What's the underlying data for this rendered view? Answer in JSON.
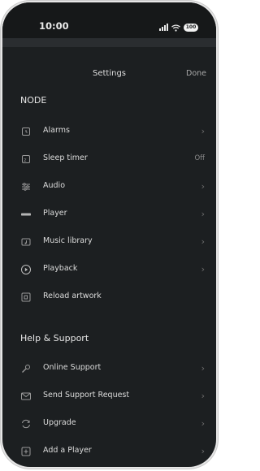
{
  "status_bar": {
    "time": "10:00",
    "battery": "100"
  },
  "header": {
    "title": "Settings",
    "done_label": "Done"
  },
  "sections": {
    "node": {
      "heading": "NODE",
      "items": [
        {
          "label": "Alarms",
          "icon": "alarm-clock-icon",
          "chevron": "›"
        },
        {
          "label": "Sleep timer",
          "icon": "sleep-timer-icon",
          "value": "Off"
        },
        {
          "label": "Audio",
          "icon": "sliders-icon",
          "chevron": "›"
        },
        {
          "label": "Player",
          "icon": "player-bar-icon",
          "chevron": "›"
        },
        {
          "label": "Music library",
          "icon": "music-library-icon",
          "chevron": "›"
        },
        {
          "label": "Playback",
          "icon": "play-circle-icon",
          "chevron": "›"
        },
        {
          "label": "Reload artwork",
          "icon": "reload-artwork-icon"
        }
      ]
    },
    "help": {
      "heading": "Help & Support",
      "items": [
        {
          "label": "Online Support",
          "icon": "wrench-icon",
          "chevron": "›"
        },
        {
          "label": "Send Support Request",
          "icon": "envelope-icon",
          "chevron": "›"
        },
        {
          "label": "Upgrade",
          "icon": "upgrade-arrows-icon",
          "chevron": "›"
        },
        {
          "label": "Add a Player",
          "icon": "add-player-icon",
          "chevron": "›"
        }
      ]
    }
  },
  "colors": {
    "background": "#1c1f21",
    "text": "#dcdcdc",
    "muted": "#8a8a8a"
  }
}
